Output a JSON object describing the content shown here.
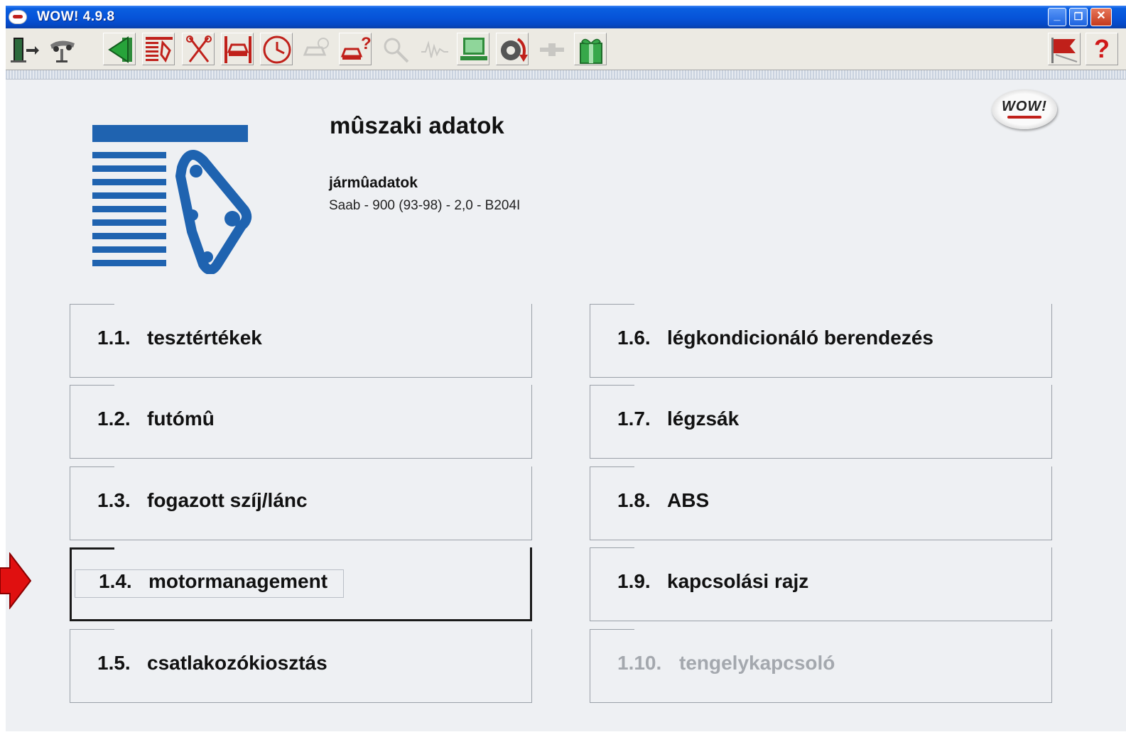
{
  "window": {
    "title": "WOW! 4.9.8",
    "controls": {
      "minimize": "_",
      "restore": "❐",
      "close": "✕"
    }
  },
  "toolbar": {
    "left_items": [
      {
        "name": "exit-door-icon",
        "state": "enabled"
      },
      {
        "name": "car-lift-icon",
        "state": "enabled"
      },
      {
        "name": "back-arrow-icon",
        "state": "enabled"
      },
      {
        "name": "technical-data-icon",
        "state": "enabled"
      },
      {
        "name": "tools-icon",
        "state": "enabled"
      },
      {
        "name": "car-service-icon",
        "state": "enabled"
      },
      {
        "name": "clock-icon",
        "state": "enabled"
      },
      {
        "name": "car-search-icon",
        "state": "disabled"
      },
      {
        "name": "car-question-icon",
        "state": "enabled"
      },
      {
        "name": "magnifier-car-icon",
        "state": "disabled"
      },
      {
        "name": "oscilloscope-icon",
        "state": "disabled"
      },
      {
        "name": "laptop-icon",
        "state": "enabled"
      },
      {
        "name": "refresh-icon",
        "state": "enabled"
      },
      {
        "name": "connector-icon",
        "state": "disabled"
      },
      {
        "name": "gift-box-icon",
        "state": "enabled"
      }
    ],
    "right_items": [
      {
        "name": "flag-icon"
      },
      {
        "name": "help-icon",
        "glyph": "?"
      }
    ]
  },
  "header": {
    "title": "mûszaki adatok",
    "section_label": "jármûadatok",
    "vehicle": "Saab - 900 (93-98) - 2,0 - B204I",
    "logo_text": "WOW!"
  },
  "menu": {
    "left": [
      {
        "number": "1.1.",
        "label": "tesztértékek",
        "state": "normal"
      },
      {
        "number": "1.2.",
        "label": "futómû",
        "state": "normal"
      },
      {
        "number": "1.3.",
        "label": "fogazott szíj/lánc",
        "state": "normal"
      },
      {
        "number": "1.4.",
        "label": "motormanagement",
        "state": "selected"
      },
      {
        "number": "1.5.",
        "label": "csatlakozókiosztás",
        "state": "normal"
      }
    ],
    "right": [
      {
        "number": "1.6.",
        "label": "légkondicionáló berendezés",
        "state": "normal"
      },
      {
        "number": "1.7.",
        "label": "légzsák",
        "state": "normal"
      },
      {
        "number": "1.8.",
        "label": "ABS",
        "state": "normal"
      },
      {
        "number": "1.9.",
        "label": "kapcsolási rajz",
        "state": "normal"
      },
      {
        "number": "1.10.",
        "label": "tengelykapcsoló",
        "state": "disabled"
      }
    ]
  },
  "colors": {
    "titlebar": "#0653d8",
    "icon_blue": "#1f63b0",
    "indicator_arrow": "#e01010",
    "disabled_text": "#a4a8ae"
  }
}
